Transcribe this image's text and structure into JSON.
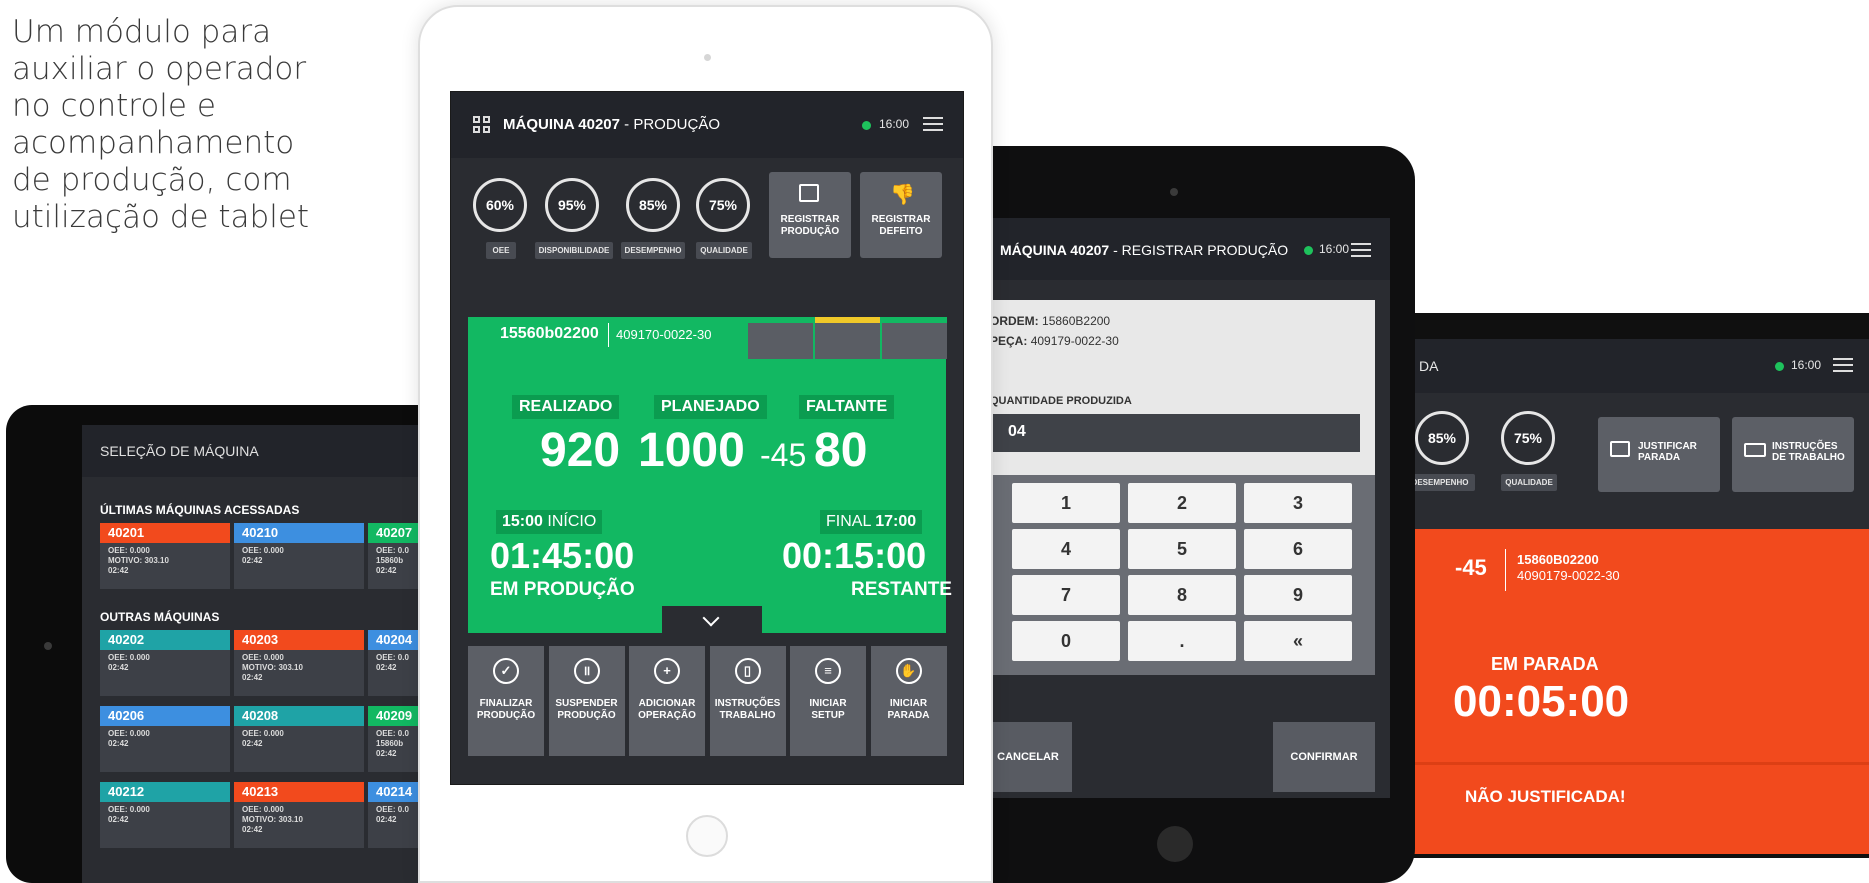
{
  "intro": {
    "lines": [
      "Um módulo para",
      "auxiliar o operador",
      "no controle e",
      "acompanhamento",
      "de produção, com",
      "utilização de tablet"
    ]
  },
  "selection_screen": {
    "title": "SELEÇÃO DE MÁQUINA",
    "recent_header": "ÚLTIMAS MÁQUINAS ACESSADAS",
    "others_header": "OUTRAS MÁQUINAS",
    "recent": [
      {
        "id": "40201",
        "color": "#f24a1d",
        "lines": [
          "OEE: 0.000",
          "MOTIVO: 303.10",
          "02:42"
        ]
      },
      {
        "id": "40210",
        "color": "#3d8fe0",
        "lines": [
          "OEE: 0.000",
          "02:42"
        ]
      },
      {
        "id": "40207",
        "color": "#12b862",
        "lines": [
          "OEE: 0.0",
          "15860b",
          "02:42"
        ]
      }
    ],
    "others": [
      {
        "id": "40202",
        "color": "#1fa3a6",
        "lines": [
          "OEE: 0.000",
          "02:42"
        ]
      },
      {
        "id": "40203",
        "color": "#f24a1d",
        "lines": [
          "OEE: 0.000",
          "MOTIVO: 303.10",
          "02:42"
        ]
      },
      {
        "id": "40204",
        "color": "#3d8fe0",
        "lines": [
          "OEE: 0.0",
          "02:42"
        ]
      },
      {
        "id": "40206",
        "color": "#3d8fe0",
        "lines": [
          "OEE: 0.000",
          "02:42"
        ]
      },
      {
        "id": "40208",
        "color": "#1fa3a6",
        "lines": [
          "OEE: 0.000",
          "02:42"
        ]
      },
      {
        "id": "40209",
        "color": "#12b862",
        "lines": [
          "OEE: 0.0",
          "15860b",
          "02:42"
        ]
      },
      {
        "id": "40212",
        "color": "#1fa3a6",
        "lines": [
          "OEE: 0.000",
          "02:42"
        ]
      },
      {
        "id": "40213",
        "color": "#f24a1d",
        "lines": [
          "OEE: 0.000",
          "MOTIVO: 303.10",
          "02:42"
        ]
      },
      {
        "id": "40214",
        "color": "#3d8fe0",
        "lines": [
          "OEE: 0.0",
          "02:42"
        ]
      }
    ]
  },
  "production_screen": {
    "machine": "MÁQUINA 40207",
    "mode": " - PRODUÇÃO",
    "time": "16:00",
    "kpis": [
      {
        "value": "60%",
        "label": "OEE"
      },
      {
        "value": "95%",
        "label": "DISPONIBILIDADE"
      },
      {
        "value": "85%",
        "label": "DESEMPENHO"
      },
      {
        "value": "75%",
        "label": "QUALIDADE"
      }
    ],
    "buttons": [
      {
        "l1": "REGISTRAR",
        "l2": "PRODUÇÃO"
      },
      {
        "l1": "REGISTRAR",
        "l2": "DEFEITO"
      }
    ],
    "order": "15560b02200",
    "part": "409170-0022-30",
    "tab_colors": [
      "#12b862",
      "#f0c929",
      "#12b862"
    ],
    "realizado_label": "REALIZADO",
    "planejado_label": "PLANEJADO",
    "faltante_label": "FALTANTE",
    "realizado": "920",
    "planejado": "1000",
    "diff": "-45",
    "faltante": "80",
    "start_time": "15:00",
    "start_label": "INÍCIO",
    "end_label": "FINAL",
    "end_time": "17:00",
    "elapsed": "01:45:00",
    "remaining": "00:15:00",
    "status_left": "EM PRODUÇÃO",
    "status_right": "RESTANTE",
    "actions": [
      {
        "icon": "check-circle-icon",
        "glyph": "✓",
        "l1": "FINALIZAR",
        "l2": "PRODUÇÃO"
      },
      {
        "icon": "pause-circle-icon",
        "glyph": "॥",
        "l1": "SUSPENDER",
        "l2": "PRODUÇÃO"
      },
      {
        "icon": "plus-circle-icon",
        "glyph": "+",
        "l1": "ADICIONAR",
        "l2": "OPERAÇÃO"
      },
      {
        "icon": "book-icon",
        "glyph": "▯",
        "l1": "INSTRUÇÕES",
        "l2": "TRABALHO"
      },
      {
        "icon": "sliders-icon",
        "glyph": "≡",
        "l1": "INICIAR",
        "l2": "SETUP"
      },
      {
        "icon": "hand-stop-icon",
        "glyph": "✋",
        "l1": "INICIAR",
        "l2": "PARADA"
      }
    ]
  },
  "register_screen": {
    "machine": "MÁQUINA 40207",
    "mode": " - REGISTRAR PRODUÇÃO",
    "time": "16:00",
    "order_label": "ORDEM:",
    "order_value": "15860B2200",
    "part_label": "PEÇA:",
    "part_value": "409179-0022-30",
    "qty_label": "QUANTIDADE PRODUZIDA",
    "qty_value": "04",
    "keys": [
      "1",
      "2",
      "3",
      "4",
      "5",
      "6",
      "7",
      "8",
      "9",
      "0",
      ".",
      "«"
    ],
    "cancel": "CANCELAR",
    "confirm": "CONFIRMAR"
  },
  "stop_screen": {
    "title_fragment": "DA",
    "time": "16:00",
    "kpis": [
      {
        "value": "85%",
        "label": "DESEMPENHO"
      },
      {
        "value": "75%",
        "label": "QUALIDADE"
      }
    ],
    "btn_justify_l1": "JUSTIFICAR",
    "btn_justify_l2": "PARADA",
    "btn_instr_l1": "INSTRUÇÕES",
    "btn_instr_l2": "DE TRABALHO",
    "diff": "-45",
    "order": "15860B02200",
    "part": "4090179-0022-30",
    "status": "EM PARADA",
    "timer": "00:05:00",
    "warning": "NÃO JUSTIFICADA!"
  }
}
